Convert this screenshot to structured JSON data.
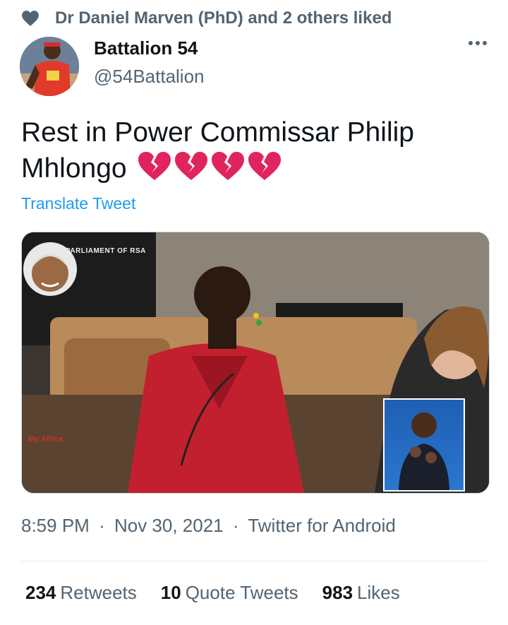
{
  "social_context": {
    "text": "Dr Daniel Marven (PhD) and 2 others liked",
    "icon": "heart-icon"
  },
  "author": {
    "name": "Battalion 54",
    "handle": "@54Battalion"
  },
  "tweet": {
    "text": "Rest in Power Commissar Philip Mhlongo",
    "emoji": "broken-heart-icon",
    "emoji_count": 4
  },
  "translate_label": "Translate Tweet",
  "media": {
    "watermark": "Parliament of RSA",
    "overlay_label": "My Africa"
  },
  "meta": {
    "time": "8:59 PM",
    "date": "Nov 30, 2021",
    "source": "Twitter for Android",
    "separator": "·"
  },
  "stats": [
    {
      "count": "234",
      "label": "Retweets"
    },
    {
      "count": "10",
      "label": "Quote Tweets"
    },
    {
      "count": "983",
      "label": "Likes"
    }
  ],
  "colors": {
    "link": "#1d9bf0",
    "muted": "#536471",
    "text": "#0f1419",
    "broken_heart": "#e0245e"
  }
}
